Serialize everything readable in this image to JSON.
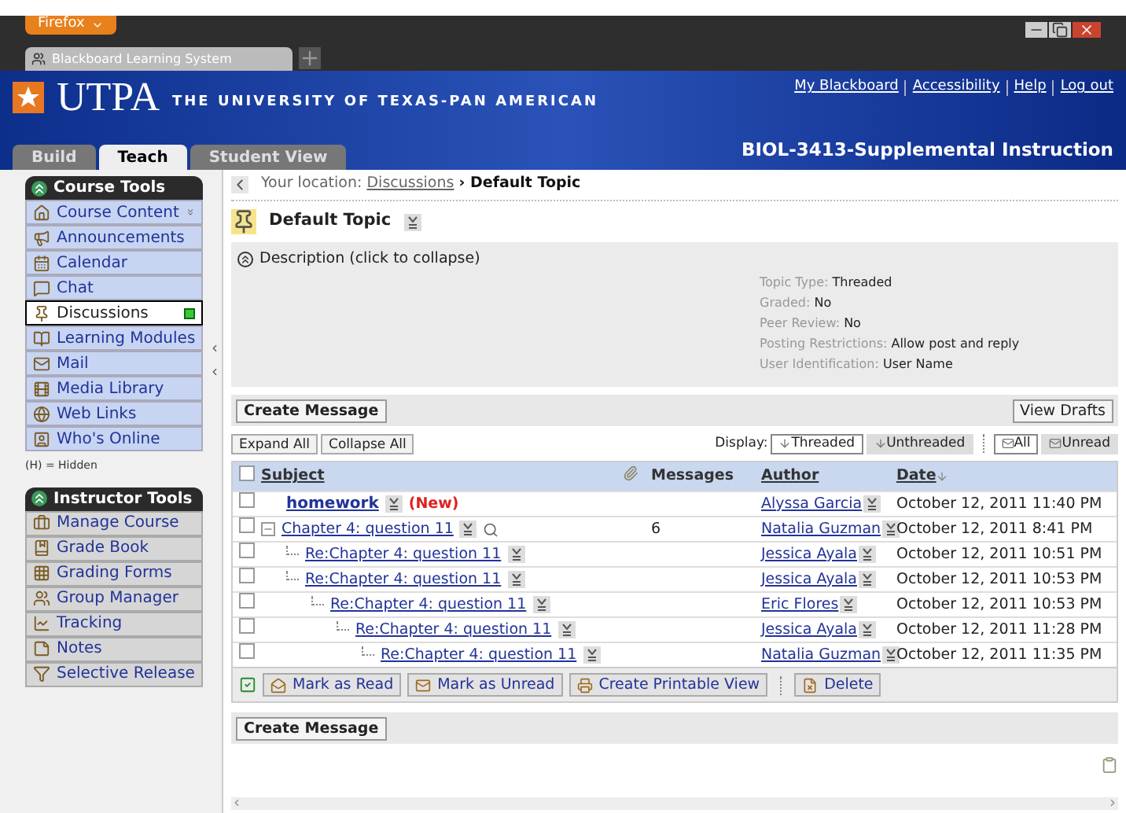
{
  "browser": {
    "menu_button": "Firefox",
    "tab_title": "Blackboard Learning System"
  },
  "header": {
    "logo_text": "UTPA",
    "university": "THE UNIVERSITY OF TEXAS-PAN AMERICAN",
    "links": [
      "My Blackboard",
      "Accessibility",
      "Help",
      "Log out"
    ],
    "tabs": [
      {
        "label": "Build",
        "selected": false
      },
      {
        "label": "Teach",
        "selected": true
      },
      {
        "label": "Student View",
        "selected": false
      }
    ],
    "course_title": "BIOL-3413-Supplemental Instruction"
  },
  "sidebar": {
    "course_tools": {
      "title": "Course Tools",
      "items": [
        {
          "label": "Course Content",
          "selected": false
        },
        {
          "label": "Announcements",
          "selected": false
        },
        {
          "label": "Calendar",
          "selected": false
        },
        {
          "label": "Chat",
          "selected": false
        },
        {
          "label": "Discussions",
          "selected": true
        },
        {
          "label": "Learning Modules",
          "selected": false
        },
        {
          "label": "Mail",
          "selected": false
        },
        {
          "label": "Media Library",
          "selected": false
        },
        {
          "label": "Web Links",
          "selected": false
        },
        {
          "label": "Who's Online",
          "selected": false
        }
      ]
    },
    "hidden_note": "(H) = Hidden",
    "instructor_tools": {
      "title": "Instructor Tools",
      "items": [
        {
          "label": "Manage Course",
          "selected": false
        },
        {
          "label": "Grade Book",
          "selected": false
        },
        {
          "label": "Grading Forms",
          "selected": false
        },
        {
          "label": "Group Manager",
          "selected": false
        },
        {
          "label": "Tracking",
          "selected": false
        },
        {
          "label": "Notes",
          "selected": false
        },
        {
          "label": "Selective Release",
          "selected": false
        }
      ]
    }
  },
  "breadcrumb": {
    "prefix": "Your location:",
    "link": "Discussions",
    "separator": "›",
    "current": "Default Topic"
  },
  "topic": {
    "title": "Default Topic",
    "description_toggle": "Description (click to collapse)",
    "properties": [
      {
        "label": "Topic Type:",
        "value": "Threaded"
      },
      {
        "label": "Graded:",
        "value": "No"
      },
      {
        "label": "Peer Review:",
        "value": "No"
      },
      {
        "label": "Posting Restrictions:",
        "value": "Allow post and reply"
      },
      {
        "label": "User Identification:",
        "value": "User Name"
      }
    ]
  },
  "create_message_top": "Create Message",
  "view_drafts": "View Drafts",
  "expand_all": "Expand All",
  "collapse_all": "Collapse All",
  "display_label": "Display:",
  "display_options": [
    {
      "label": "Threaded",
      "selected": true
    },
    {
      "label": "Unthreaded",
      "selected": false
    }
  ],
  "filter_options": [
    {
      "label": "All",
      "selected": true
    },
    {
      "label": "Unread",
      "selected": false
    }
  ],
  "table": {
    "select_all_checked": false,
    "columns": [
      "Subject",
      "Messages",
      "Author",
      "Date"
    ],
    "rows": [
      {
        "subject": "homework",
        "unread": true,
        "new_label": "(New)",
        "author": "Alyssa Garcia",
        "date": "October 12, 2011 11:40 PM",
        "checked": false
      },
      {
        "subject": "Chapter 4: question 11",
        "unread": false,
        "messages": "6",
        "expanded": true,
        "author": "Natalia Guzman",
        "date": "October 12, 2011 8:41 PM",
        "checked": false,
        "children": [
          {
            "subject": "Re:Chapter 4: question 11",
            "unread": false,
            "author": "Jessica Ayala",
            "date": "October 12, 2011 10:51 PM",
            "checked": false
          },
          {
            "subject": "Re:Chapter 4: question 11",
            "unread": false,
            "author": "Jessica Ayala",
            "date": "October 12, 2011 10:53 PM",
            "checked": false,
            "children": [
              {
                "subject": "Re:Chapter 4: question 11",
                "unread": false,
                "author": "Eric Flores",
                "date": "October 12, 2011 10:53 PM",
                "checked": false,
                "children": [
                  {
                    "subject": "Re:Chapter 4: question 11",
                    "unread": false,
                    "author": "Jessica Ayala",
                    "date": "October 12, 2011 11:28 PM",
                    "checked": false,
                    "children": [
                      {
                        "subject": "Re:Chapter 4: question 11",
                        "unread": false,
                        "author": "Natalia Guzman",
                        "date": "October 12, 2011 11:35 PM",
                        "checked": false
                      }
                    ]
                  }
                ]
              }
            ]
          }
        ]
      }
    ]
  },
  "actions": [
    {
      "kind": "read",
      "label": "Mark as Read"
    },
    {
      "kind": "unread",
      "label": "Mark as Unread"
    },
    {
      "kind": "print",
      "label": "Create Printable View"
    },
    {
      "kind": "delete",
      "label": "Delete"
    }
  ],
  "create_message_bottom": "Create Message"
}
